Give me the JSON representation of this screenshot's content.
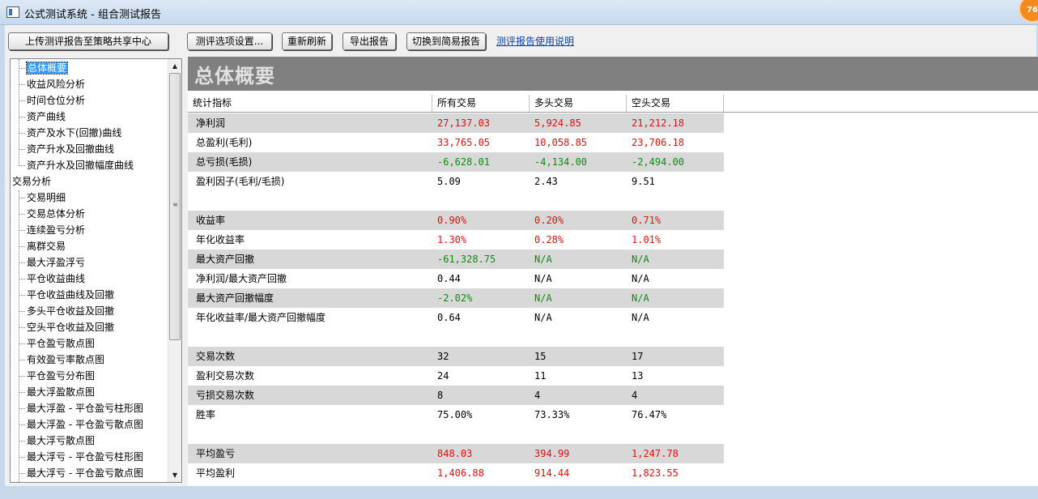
{
  "window": {
    "title": "公式测试系统 - 组合测试报告",
    "badge": "76"
  },
  "toolbar": {
    "upload_label": "上传测评报告至策略共享中心",
    "options_label": "测评选项设置...",
    "refresh_label": "重新刷新",
    "export_label": "导出报告",
    "switch_label": "切换到简易报告",
    "help_link": "测评报告使用说明"
  },
  "sidebar": {
    "items": [
      {
        "label": "总体概要",
        "level": 1,
        "selected": true
      },
      {
        "label": "收益风险分析",
        "level": 1
      },
      {
        "label": "时间仓位分析",
        "level": 1
      },
      {
        "label": "资产曲线",
        "level": 1
      },
      {
        "label": "资产及水下(回撤)曲线",
        "level": 1
      },
      {
        "label": "资产升水及回撤曲线",
        "level": 1
      },
      {
        "label": "资产升水及回撤幅度曲线",
        "level": 1
      },
      {
        "label": "交易分析",
        "level": 0
      },
      {
        "label": "交易明细",
        "level": 1
      },
      {
        "label": "交易总体分析",
        "level": 1
      },
      {
        "label": "连续盈亏分析",
        "level": 1
      },
      {
        "label": "离群交易",
        "level": 1
      },
      {
        "label": "最大浮盈浮亏",
        "level": 1
      },
      {
        "label": "平仓收益曲线",
        "level": 1
      },
      {
        "label": "平仓收益曲线及回撤",
        "level": 1
      },
      {
        "label": "多头平仓收益及回撤",
        "level": 1
      },
      {
        "label": "空头平仓收益及回撤",
        "level": 1
      },
      {
        "label": "平仓盈亏散点图",
        "level": 1
      },
      {
        "label": "有效盈亏率散点图",
        "level": 1
      },
      {
        "label": "平仓盈亏分布图",
        "level": 1
      },
      {
        "label": "最大浮盈散点图",
        "level": 1
      },
      {
        "label": "最大浮盈 - 平仓盈亏柱形图",
        "level": 1
      },
      {
        "label": "最大浮盈 - 平仓盈亏散点图",
        "level": 1
      },
      {
        "label": "最大浮亏散点图",
        "level": 1
      },
      {
        "label": "最大浮亏 - 平仓盈亏柱形图",
        "level": 1
      },
      {
        "label": "最大浮亏 - 平仓盈亏散点图",
        "level": 1
      }
    ]
  },
  "report": {
    "heading": "总体概要",
    "columns": [
      "统计指标",
      "所有交易",
      "多头交易",
      "空头交易"
    ],
    "rows": [
      {
        "label": "净利润",
        "values": [
          "27,137.03",
          "5,924.85",
          "21,212.18"
        ],
        "color": "red",
        "shade": true
      },
      {
        "label": "总盈利(毛利)",
        "values": [
          "33,765.05",
          "10,058.85",
          "23,706.18"
        ],
        "color": "red",
        "shade": false
      },
      {
        "label": "总亏损(毛损)",
        "values": [
          "-6,628.01",
          "-4,134.00",
          "-2,494.00"
        ],
        "color": "green",
        "shade": true
      },
      {
        "label": "盈利因子(毛利/毛损)",
        "values": [
          "5.09",
          "2.43",
          "9.51"
        ],
        "color": "black",
        "shade": false
      },
      {
        "label": "",
        "values": [
          "",
          "",
          ""
        ],
        "color": "black",
        "shade": false
      },
      {
        "label": "收益率",
        "values": [
          "0.90%",
          "0.20%",
          "0.71%"
        ],
        "color": "red",
        "shade": true
      },
      {
        "label": "年化收益率",
        "values": [
          "1.30%",
          "0.28%",
          "1.01%"
        ],
        "color": "red",
        "shade": false
      },
      {
        "label": "最大资产回撤",
        "values": [
          "-61,328.75",
          "N/A",
          "N/A"
        ],
        "color": "green",
        "shade": true
      },
      {
        "label": "净利润/最大资产回撤",
        "values": [
          "0.44",
          "N/A",
          "N/A"
        ],
        "color": "black",
        "shade": false
      },
      {
        "label": "最大资产回撤幅度",
        "values": [
          "-2.02%",
          "N/A",
          "N/A"
        ],
        "color": "green",
        "shade": true
      },
      {
        "label": "年化收益率/最大资产回撤幅度",
        "values": [
          "0.64",
          "N/A",
          "N/A"
        ],
        "color": "black",
        "shade": false
      },
      {
        "label": "",
        "values": [
          "",
          "",
          ""
        ],
        "color": "black",
        "shade": false
      },
      {
        "label": "交易次数",
        "values": [
          "32",
          "15",
          "17"
        ],
        "color": "black",
        "shade": true
      },
      {
        "label": "盈利交易次数",
        "values": [
          "24",
          "11",
          "13"
        ],
        "color": "black",
        "shade": false
      },
      {
        "label": "亏损交易次数",
        "values": [
          "8",
          "4",
          "4"
        ],
        "color": "black",
        "shade": true
      },
      {
        "label": "胜率",
        "values": [
          "75.00%",
          "73.33%",
          "76.47%"
        ],
        "color": "black",
        "shade": false
      },
      {
        "label": "",
        "values": [
          "",
          "",
          ""
        ],
        "color": "black",
        "shade": false
      },
      {
        "label": "平均盈亏",
        "values": [
          "848.03",
          "394.99",
          "1,247.78"
        ],
        "color": "red",
        "shade": true
      },
      {
        "label": "平均盈利",
        "values": [
          "1,406.88",
          "914.44",
          "1,823.55"
        ],
        "color": "red",
        "shade": false
      }
    ]
  },
  "colors": {
    "positive": "#e01010",
    "negative": "#128a12",
    "header_band": "#808080",
    "row_shade": "#d8d8d8",
    "selection": "#3399ff"
  }
}
